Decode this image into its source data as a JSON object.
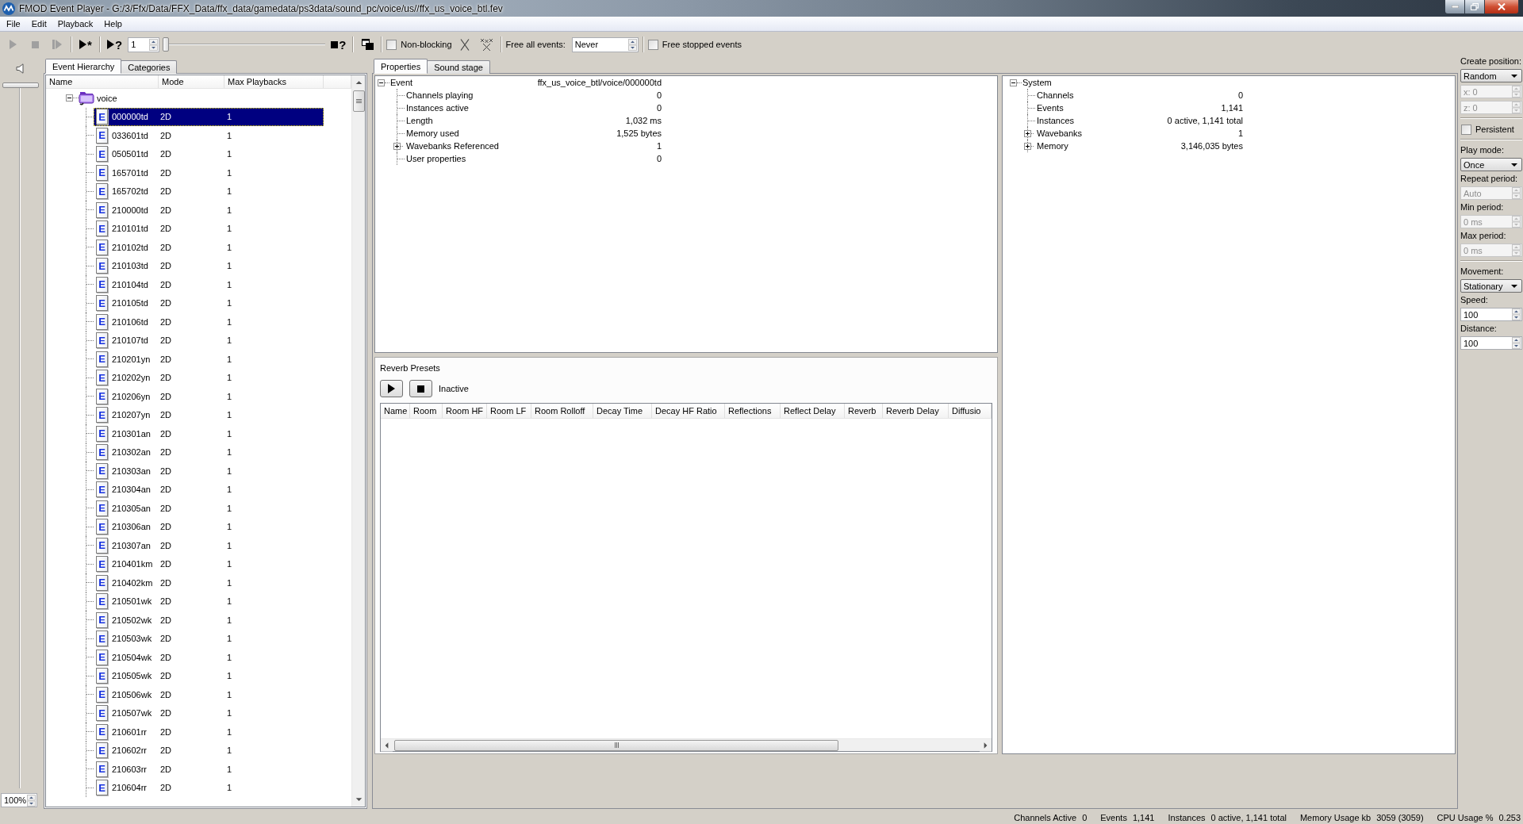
{
  "window": {
    "title": "FMOD Event Player - G:/3/Ffx/Data/FFX_Data/ffx_data/gamedata/ps3data/sound_pc/voice/us//ffx_us_voice_btl.fev"
  },
  "menu": [
    "File",
    "Edit",
    "Playback",
    "Help"
  ],
  "toolbar": {
    "groups": [
      [
        {
          "kind": "play",
          "disabled": true
        },
        {
          "kind": "stop",
          "disabled": true
        },
        {
          "kind": "step",
          "disabled": true
        }
      ],
      [
        {
          "kind": "play-all",
          "text": "*",
          "disabled": false
        }
      ],
      [
        {
          "kind": "play-query",
          "text": "?",
          "disabled": false
        },
        {
          "kind": "spin",
          "value": "1"
        },
        {
          "kind": "slider",
          "level": 0
        },
        {
          "kind": "stop-query",
          "text": "?",
          "disabled": false
        }
      ],
      [
        {
          "kind": "windows",
          "disabled": false
        }
      ],
      [
        {
          "kind": "checkbox",
          "label": "Non-blocking",
          "checked": false
        },
        {
          "kind": "clear",
          "disabled": false
        },
        {
          "kind": "clear-all",
          "disabled": false
        }
      ],
      [
        {
          "kind": "label",
          "text": "Free all events:"
        },
        {
          "kind": "spin",
          "value": "Never"
        }
      ],
      [
        {
          "kind": "checkbox",
          "label": "Free stopped events",
          "checked": false
        }
      ]
    ]
  },
  "volume": {
    "level": 1
  },
  "zoom": {
    "value": "100%"
  },
  "event_hierarchy": {
    "tabs": [
      {
        "label": "Event Hierarchy",
        "selected": true
      },
      {
        "label": "Categories",
        "selected": false
      }
    ],
    "columns": [
      "Name",
      "Mode",
      "Max Playbacks"
    ],
    "tree": [
      {
        "name": "voice",
        "expanded": true,
        "selected": false,
        "children": [
          {
            "badge": "E",
            "name": "000000td",
            "mode": "2D",
            "max_playbacks": "1",
            "selected": true
          },
          {
            "badge": "E",
            "name": "033601td",
            "mode": "2D",
            "max_playbacks": "1",
            "selected": false
          },
          {
            "badge": "E",
            "name": "050501td",
            "mode": "2D",
            "max_playbacks": "1",
            "selected": false
          },
          {
            "badge": "E",
            "name": "165701td",
            "mode": "2D",
            "max_playbacks": "1",
            "selected": false
          },
          {
            "badge": "E",
            "name": "165702td",
            "mode": "2D",
            "max_playbacks": "1",
            "selected": false
          },
          {
            "badge": "E",
            "name": "210000td",
            "mode": "2D",
            "max_playbacks": "1",
            "selected": false
          },
          {
            "badge": "E",
            "name": "210101td",
            "mode": "2D",
            "max_playbacks": "1",
            "selected": false
          },
          {
            "badge": "E",
            "name": "210102td",
            "mode": "2D",
            "max_playbacks": "1",
            "selected": false
          },
          {
            "badge": "E",
            "name": "210103td",
            "mode": "2D",
            "max_playbacks": "1",
            "selected": false
          },
          {
            "badge": "E",
            "name": "210104td",
            "mode": "2D",
            "max_playbacks": "1",
            "selected": false
          },
          {
            "badge": "E",
            "name": "210105td",
            "mode": "2D",
            "max_playbacks": "1",
            "selected": false
          },
          {
            "badge": "E",
            "name": "210106td",
            "mode": "2D",
            "max_playbacks": "1",
            "selected": false
          },
          {
            "badge": "E",
            "name": "210107td",
            "mode": "2D",
            "max_playbacks": "1",
            "selected": false
          },
          {
            "badge": "E",
            "name": "210201yn",
            "mode": "2D",
            "max_playbacks": "1",
            "selected": false
          },
          {
            "badge": "E",
            "name": "210202yn",
            "mode": "2D",
            "max_playbacks": "1",
            "selected": false
          },
          {
            "badge": "E",
            "name": "210206yn",
            "mode": "2D",
            "max_playbacks": "1",
            "selected": false
          },
          {
            "badge": "E",
            "name": "210207yn",
            "mode": "2D",
            "max_playbacks": "1",
            "selected": false
          },
          {
            "badge": "E",
            "name": "210301an",
            "mode": "2D",
            "max_playbacks": "1",
            "selected": false
          },
          {
            "badge": "E",
            "name": "210302an",
            "mode": "2D",
            "max_playbacks": "1",
            "selected": false
          },
          {
            "badge": "E",
            "name": "210303an",
            "mode": "2D",
            "max_playbacks": "1",
            "selected": false
          },
          {
            "badge": "E",
            "name": "210304an",
            "mode": "2D",
            "max_playbacks": "1",
            "selected": false
          },
          {
            "badge": "E",
            "name": "210305an",
            "mode": "2D",
            "max_playbacks": "1",
            "selected": false
          },
          {
            "badge": "E",
            "name": "210306an",
            "mode": "2D",
            "max_playbacks": "1",
            "selected": false
          },
          {
            "badge": "E",
            "name": "210307an",
            "mode": "2D",
            "max_playbacks": "1",
            "selected": false
          },
          {
            "badge": "E",
            "name": "210401km",
            "mode": "2D",
            "max_playbacks": "1",
            "selected": false
          },
          {
            "badge": "E",
            "name": "210402km",
            "mode": "2D",
            "max_playbacks": "1",
            "selected": false
          },
          {
            "badge": "E",
            "name": "210501wk",
            "mode": "2D",
            "max_playbacks": "1",
            "selected": false
          },
          {
            "badge": "E",
            "name": "210502wk",
            "mode": "2D",
            "max_playbacks": "1",
            "selected": false
          },
          {
            "badge": "E",
            "name": "210503wk",
            "mode": "2D",
            "max_playbacks": "1",
            "selected": false
          },
          {
            "badge": "E",
            "name": "210504wk",
            "mode": "2D",
            "max_playbacks": "1",
            "selected": false
          },
          {
            "badge": "E",
            "name": "210505wk",
            "mode": "2D",
            "max_playbacks": "1",
            "selected": false
          },
          {
            "badge": "E",
            "name": "210506wk",
            "mode": "2D",
            "max_playbacks": "1",
            "selected": false
          },
          {
            "badge": "E",
            "name": "210507wk",
            "mode": "2D",
            "max_playbacks": "1",
            "selected": false
          },
          {
            "badge": "E",
            "name": "210601rr",
            "mode": "2D",
            "max_playbacks": "1",
            "selected": false
          },
          {
            "badge": "E",
            "name": "210602rr",
            "mode": "2D",
            "max_playbacks": "1",
            "selected": false
          },
          {
            "badge": "E",
            "name": "210603rr",
            "mode": "2D",
            "max_playbacks": "1",
            "selected": false
          },
          {
            "badge": "E",
            "name": "210604rr",
            "mode": "2D",
            "max_playbacks": "1",
            "selected": false
          }
        ]
      }
    ]
  },
  "properties": {
    "tabs": [
      {
        "label": "Properties",
        "selected": true
      },
      {
        "label": "Sound stage",
        "selected": false
      }
    ],
    "tree": [
      {
        "name": "Event",
        "value": "ffx_us_voice_btl/voice/000000td",
        "expanded": true,
        "children": [
          {
            "name": "Channels playing",
            "value": "0"
          },
          {
            "name": "Instances active",
            "value": "0"
          },
          {
            "name": "Length",
            "value": "1,032 ms"
          },
          {
            "name": "Memory used",
            "value": "1,525 bytes"
          },
          {
            "name": "Wavebanks Referenced",
            "value": "1",
            "expanded": false
          },
          {
            "name": "User properties",
            "value": "0"
          }
        ]
      }
    ]
  },
  "system": {
    "tree": [
      {
        "name": "System",
        "expanded": true,
        "children": [
          {
            "name": "Channels",
            "value": "0"
          },
          {
            "name": "Events",
            "value": "1,141"
          },
          {
            "name": "Instances",
            "value": "0 active, 1,141 total"
          },
          {
            "name": "Wavebanks",
            "value": "1",
            "expanded": false
          },
          {
            "name": "Memory",
            "value": "3,146,035 bytes",
            "expanded": false
          }
        ]
      }
    ]
  },
  "reverb_presets": {
    "title": "Reverb Presets",
    "status": "Inactive",
    "columns": [
      "Name",
      "Room",
      "Room HF",
      "Room LF",
      "Room Rolloff",
      "Decay Time",
      "Decay HF Ratio",
      "Reflections",
      "Reflect Delay",
      "Reverb",
      "Reverb Delay",
      "Diffusio"
    ]
  },
  "sound_settings": {
    "sections": [
      [
        {
          "kind": "label",
          "text": "Create position:"
        },
        {
          "kind": "dropdown",
          "value": "Random"
        },
        {
          "kind": "spin",
          "value": "x: 0",
          "disabled": true
        },
        {
          "kind": "spin",
          "value": "z: 0",
          "disabled": true
        }
      ],
      [
        {
          "kind": "checkbox",
          "label": "Persistent",
          "checked": false
        }
      ],
      [
        {
          "kind": "label",
          "text": "Play mode:"
        },
        {
          "kind": "dropdown",
          "value": "Once"
        },
        {
          "kind": "label",
          "text": "Repeat period:"
        },
        {
          "kind": "spin",
          "value": "Auto",
          "disabled": true
        },
        {
          "kind": "label",
          "text": "Min period:"
        },
        {
          "kind": "spin",
          "value": "0 ms",
          "disabled": true
        },
        {
          "kind": "label",
          "text": "Max period:"
        },
        {
          "kind": "spin",
          "value": "0 ms",
          "disabled": true
        }
      ],
      [
        {
          "kind": "label",
          "text": "Movement:"
        },
        {
          "kind": "dropdown",
          "value": "Stationary"
        },
        {
          "kind": "label",
          "text": "Speed:"
        },
        {
          "kind": "spin",
          "value": "100",
          "disabled": false
        },
        {
          "kind": "label",
          "text": "Distance:"
        },
        {
          "kind": "spin",
          "value": "100",
          "disabled": false
        }
      ]
    ]
  },
  "status_bar": [
    {
      "label": "Channels Active",
      "value": "0"
    },
    {
      "label": "Events",
      "value": "1,141"
    },
    {
      "label": "Instances",
      "value": "0 active, 1,141 total"
    },
    {
      "label": "Memory Usage kb",
      "value": "3059 (3059)"
    },
    {
      "label": "CPU Usage %",
      "value": "0.253"
    }
  ]
}
